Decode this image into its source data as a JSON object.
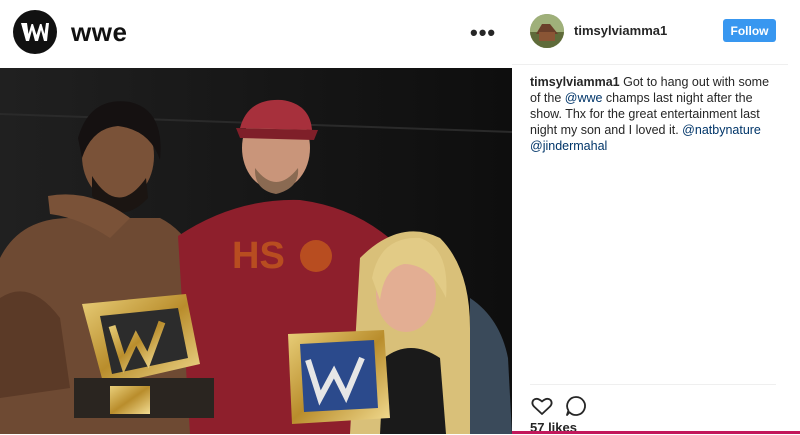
{
  "header": {
    "brand_title": "wwe",
    "logo_text": "W",
    "more_icon": "more-dots-icon"
  },
  "post": {
    "username": "timsylviamma1",
    "follow_label": "Follow",
    "caption": {
      "author": "timsylviamma1",
      "text_1": " Got to hang out with some of the ",
      "mention_1": "@wwe",
      "text_2": " champs last night after the show. Thx for the great entertainment last night my son and I loved it. ",
      "mention_2": "@natbynature",
      "text_3": " ",
      "mention_3": "@jindermahal"
    },
    "likes": "57 likes",
    "icons": [
      "heart-icon",
      "comment-icon"
    ]
  },
  "colors": {
    "follow_blue": "#3897f0",
    "mention_blue": "#003569",
    "accent_line": "#c2185b"
  }
}
